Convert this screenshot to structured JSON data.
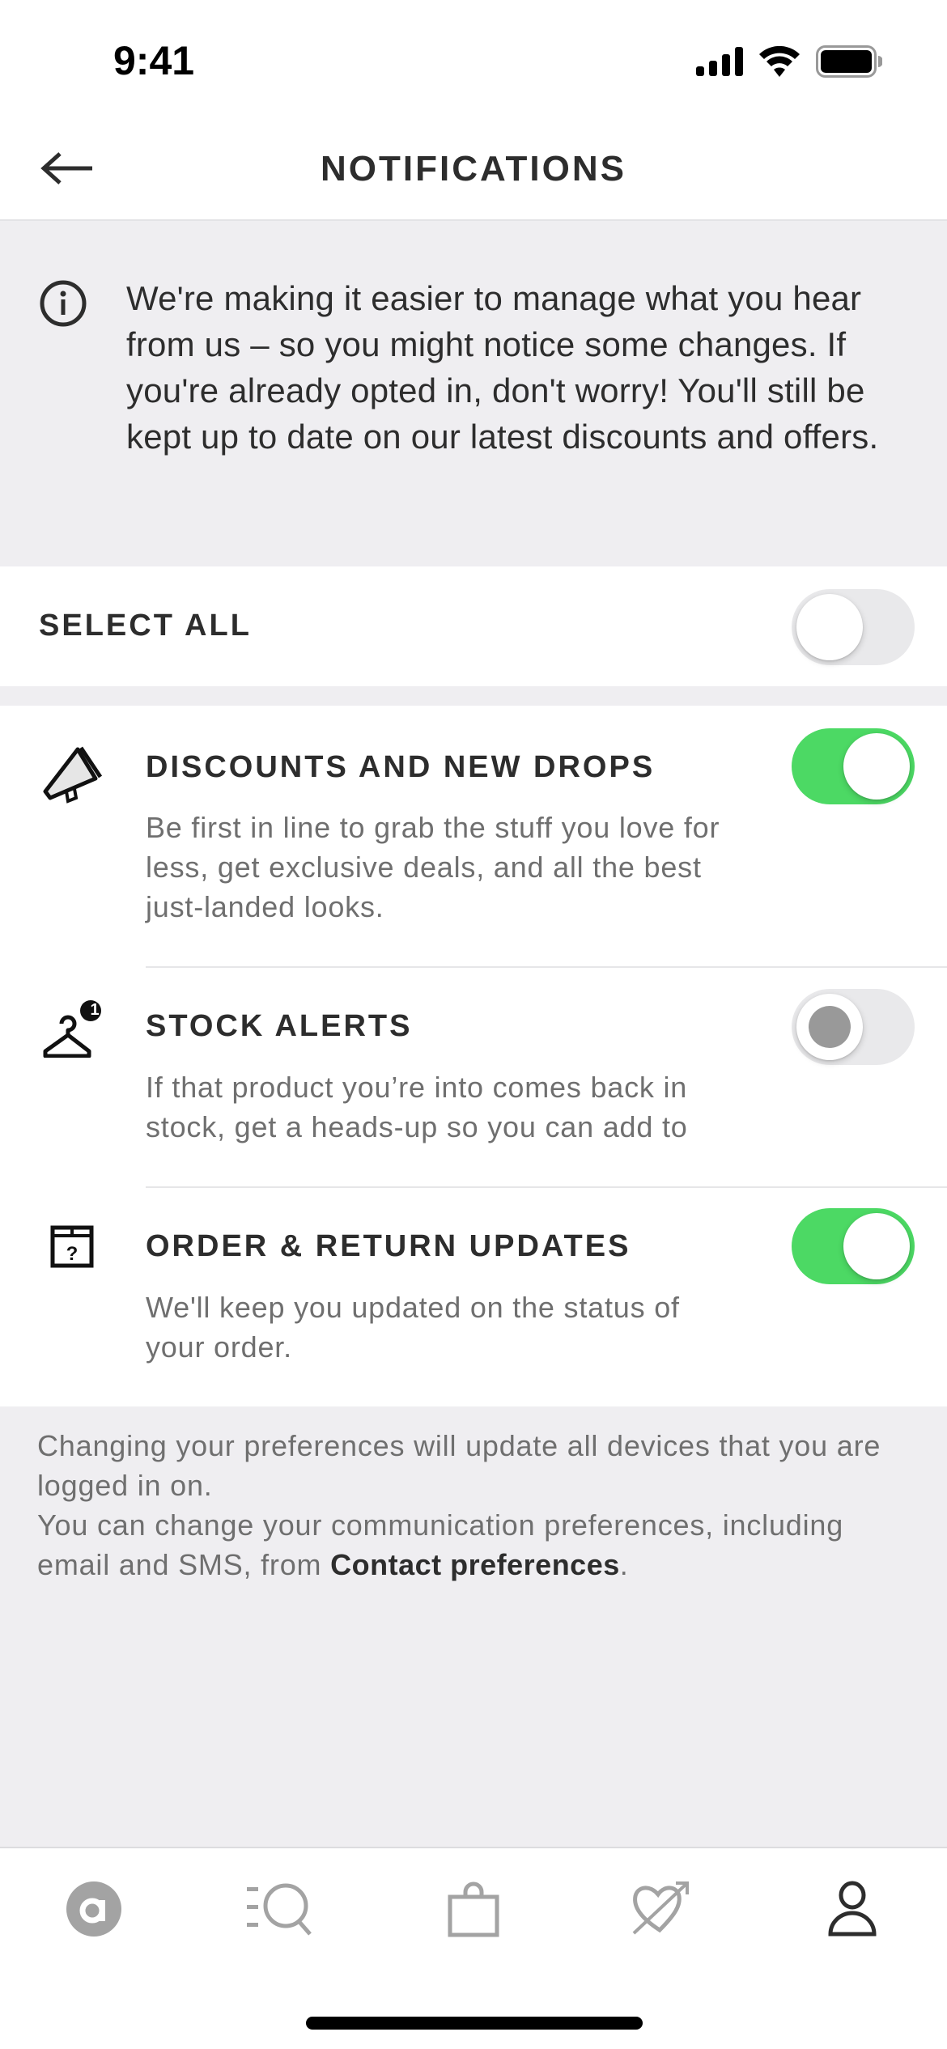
{
  "status_bar": {
    "time": "9:41",
    "icons": [
      "cellular-signal-icon",
      "wifi-icon",
      "battery-icon"
    ]
  },
  "header": {
    "back_icon": "arrow-left-icon",
    "title": "NOTIFICATIONS"
  },
  "info_banner": {
    "icon": "info-circle-icon",
    "text": "We're making it easier to manage what you hear from us – so you might notice some changes. If you're already opted in, don't worry! You'll still be kept up to date on our latest discounts and offers."
  },
  "select_all": {
    "label": "SELECT ALL",
    "enabled": false
  },
  "preferences": [
    {
      "icon": "megaphone-icon",
      "title": "DISCOUNTS AND NEW DROPS",
      "description": "Be first in line to grab the stuff you love for less, get exclusive deals, and all the best just-landed looks.",
      "enabled": true
    },
    {
      "icon": "hanger-icon",
      "badge": "1",
      "title": "STOCK ALERTS",
      "description": "If that product you’re into comes back in stock, get a heads-up so you can add to",
      "enabled": false,
      "loading": true
    },
    {
      "icon": "box-question-icon",
      "title": "ORDER & RETURN UPDATES",
      "description": "We'll keep you updated on the status of your order.",
      "enabled": true
    }
  ],
  "footer": {
    "line1": "Changing your preferences will update all devices that you are logged in on.",
    "line2_prefix": "You can change your communication preferences, including email and SMS, from ",
    "link": "Contact preferences",
    "line2_suffix": "."
  },
  "tab_bar": {
    "tabs": [
      {
        "name": "home",
        "icon": "asos-logo-icon",
        "active": false
      },
      {
        "name": "search",
        "icon": "search-icon",
        "active": false
      },
      {
        "name": "bag",
        "icon": "shopping-bag-icon",
        "active": false
      },
      {
        "name": "saved",
        "icon": "heart-arrow-icon",
        "active": false
      },
      {
        "name": "account",
        "icon": "user-icon",
        "active": true
      }
    ]
  },
  "colors": {
    "toggle_on": "#4cd964",
    "toggle_off": "#e9e9eb",
    "text_primary": "#2d2d2d",
    "text_secondary": "#6f6f6f",
    "background": "#efeef1",
    "tab_inactive": "#9b9b9b",
    "tab_active": "#2d2d2d"
  }
}
